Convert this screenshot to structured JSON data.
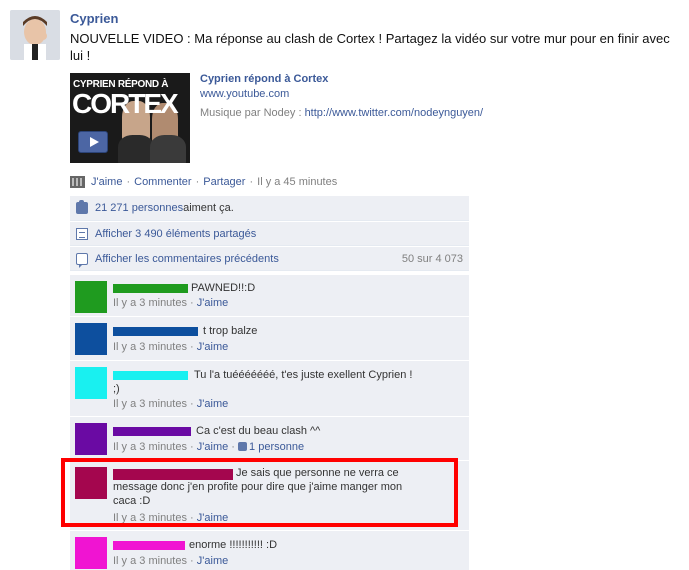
{
  "post": {
    "author": "Cyprien",
    "message": "NOUVELLE VIDEO : Ma réponse au clash de Cortex ! Partagez la vidéo sur votre mur pour en finir avec lui !",
    "attachment": {
      "thumb_caption": "CYPRIEN  RÉPOND À",
      "thumb_word": "CORTEX",
      "title": "Cyprien répond à Cortex",
      "domain": "www.youtube.com",
      "desc_prefix": "Musique par Nodey : ",
      "desc_link": "http://www.twitter.com/nodeynguyen/"
    },
    "actions": {
      "like": "J'aime",
      "sep": "·",
      "comment": "Commenter",
      "share": "Partager",
      "time": "Il y a 45 minutes"
    }
  },
  "ufi": {
    "likes_count": "21 271 personnes",
    "likes_suffix": " aiment ça.",
    "shares": "Afficher 3 490 éléments partagés",
    "previous": "Afficher les commentaires précédents",
    "count": "50 sur 4 073"
  },
  "comments": [
    {
      "text": "PAWNED!!:D",
      "time": "Il y a 3 minutes",
      "sep": "·",
      "like": "J'aime",
      "color": "#1f9b1f",
      "name_color": "#1f9b1f"
    },
    {
      "text": "t trop balze",
      "time": "Il y a 3 minutes",
      "sep": "·",
      "like": "J'aime",
      "color": "#0d4f9e",
      "name_color": "#0d4f9e"
    },
    {
      "text_line1": "Tu l'a tuééééééé, t'es juste exellent Cyprien !",
      "text_line2": ";)",
      "time": "Il y a 3 minutes",
      "sep": "·",
      "like": "J'aime",
      "color": "#19f0f0",
      "name_color": "#19f0f0"
    },
    {
      "text": "Ca c'est du beau clash ^^",
      "time": "Il y a 3 minutes",
      "sep": "·",
      "like": "J'aime",
      "likes": "1 personne",
      "color": "#6a0aa3",
      "name_color": "#6a0aa3"
    },
    {
      "text_line1": "Je sais que personne ne verra ce",
      "text_line2": "message donc j'en profite pour dire que j'aime manger mon",
      "text_line3": "caca :D",
      "time": "Il y a 3 minutes",
      "sep": "·",
      "like": "J'aime",
      "color": "#a4064e",
      "name_color": "#a4064e"
    },
    {
      "text": "enorme !!!!!!!!!!! :D",
      "time": "Il y a 3 minutes",
      "sep": "·",
      "like": "J'aime",
      "color": "#f014d2",
      "name_color": "#f014d2"
    }
  ],
  "colors": {
    "link": "#3b5998",
    "ufi_bg": "#edeff4",
    "highlight": "#ff0000"
  }
}
